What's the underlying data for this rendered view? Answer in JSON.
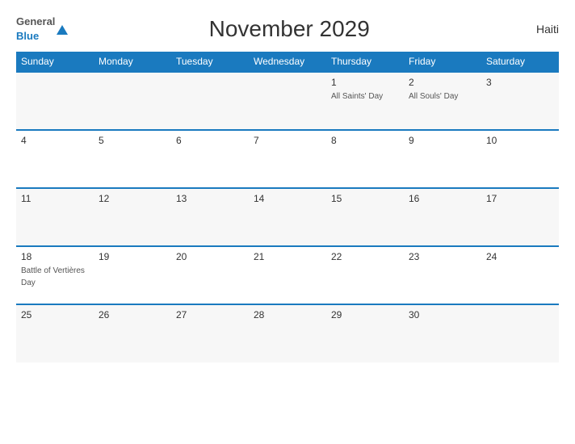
{
  "header": {
    "logo_general": "General",
    "logo_blue": "Blue",
    "title": "November 2029",
    "country": "Haiti"
  },
  "weekdays": [
    "Sunday",
    "Monday",
    "Tuesday",
    "Wednesday",
    "Thursday",
    "Friday",
    "Saturday"
  ],
  "weeks": [
    [
      {
        "day": "",
        "event": ""
      },
      {
        "day": "",
        "event": ""
      },
      {
        "day": "",
        "event": ""
      },
      {
        "day": "",
        "event": ""
      },
      {
        "day": "1",
        "event": "All Saints' Day"
      },
      {
        "day": "2",
        "event": "All Souls' Day"
      },
      {
        "day": "3",
        "event": ""
      }
    ],
    [
      {
        "day": "4",
        "event": ""
      },
      {
        "day": "5",
        "event": ""
      },
      {
        "day": "6",
        "event": ""
      },
      {
        "day": "7",
        "event": ""
      },
      {
        "day": "8",
        "event": ""
      },
      {
        "day": "9",
        "event": ""
      },
      {
        "day": "10",
        "event": ""
      }
    ],
    [
      {
        "day": "11",
        "event": ""
      },
      {
        "day": "12",
        "event": ""
      },
      {
        "day": "13",
        "event": ""
      },
      {
        "day": "14",
        "event": ""
      },
      {
        "day": "15",
        "event": ""
      },
      {
        "day": "16",
        "event": ""
      },
      {
        "day": "17",
        "event": ""
      }
    ],
    [
      {
        "day": "18",
        "event": "Battle of Vertières Day"
      },
      {
        "day": "19",
        "event": ""
      },
      {
        "day": "20",
        "event": ""
      },
      {
        "day": "21",
        "event": ""
      },
      {
        "day": "22",
        "event": ""
      },
      {
        "day": "23",
        "event": ""
      },
      {
        "day": "24",
        "event": ""
      }
    ],
    [
      {
        "day": "25",
        "event": ""
      },
      {
        "day": "26",
        "event": ""
      },
      {
        "day": "27",
        "event": ""
      },
      {
        "day": "28",
        "event": ""
      },
      {
        "day": "29",
        "event": ""
      },
      {
        "day": "30",
        "event": ""
      },
      {
        "day": "",
        "event": ""
      }
    ]
  ]
}
